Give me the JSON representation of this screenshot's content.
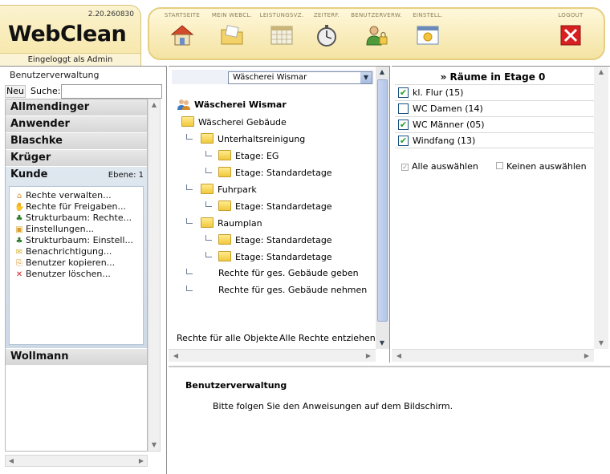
{
  "header": {
    "version": "2.20.260830",
    "brand": "WebClean",
    "logged_in": "Eingeloggt als Admin",
    "nav": [
      {
        "label": "STARTSEITE",
        "icon": "house-icon"
      },
      {
        "label": "MEIN WEBCL.",
        "icon": "folder-icon"
      },
      {
        "label": "LEISTUNGSVZ.",
        "icon": "calendar-icon"
      },
      {
        "label": "ZEITERF.",
        "icon": "stopwatch-icon"
      },
      {
        "label": "BENUTZERVERW.",
        "icon": "user-lock-icon"
      },
      {
        "label": "EINSTELL.",
        "icon": "settings-window-icon"
      },
      {
        "label": "LOGOUT",
        "icon": "close-icon"
      }
    ]
  },
  "left": {
    "title": "Benutzerverwaltung",
    "new_label": "Neu",
    "search_label": "Suche:",
    "search_value": "",
    "users": [
      "Allmendinger",
      "Anwender",
      "Blaschke",
      "Krüger",
      "Kunde",
      "Wollmann"
    ],
    "active_user": "Kunde",
    "active_level": "Ebene: 1",
    "menu": [
      {
        "label": "Rechte verwalten...",
        "icon": "house-small-icon"
      },
      {
        "label": "Rechte für Freigaben...",
        "icon": "share-icon"
      },
      {
        "label": "Strukturbaum: Rechte...",
        "icon": "tree-icon"
      },
      {
        "label": "Einstellungen...",
        "icon": "settings-icon"
      },
      {
        "label": "Strukturbaum: Einstell...",
        "icon": "tree-icon"
      },
      {
        "label": "Benachrichtigung...",
        "icon": "mail-icon"
      },
      {
        "label": "Benutzer kopieren...",
        "icon": "copy-icon"
      },
      {
        "label": "Benutzer löschen...",
        "icon": "delete-icon"
      }
    ]
  },
  "middle": {
    "select_value": "Wäscherei Wismar",
    "root": "Wäscherei Wismar",
    "tree": {
      "building": "Wäscherei Gebäude",
      "unterhalt": "Unterhaltsreinigung",
      "etage_eg": "Etage: EG",
      "etage_std_1": "Etage: Standardetage",
      "fuhrpark": "Fuhrpark",
      "etage_std_2": "Etage: Standardetage",
      "raumplan": "Raumplan",
      "etage_std_3": "Etage: Standardetage",
      "etage_std_4": "Etage: Standardetage",
      "rights_give": "Rechte für ges. Gebäude geben",
      "rights_take": "Rechte für ges. Gebäude nehmen"
    },
    "footer_all": "Rechte für alle Objekte",
    "footer_revoke": "Alle Rechte entziehen"
  },
  "right": {
    "title": "» Räume in Etage 0",
    "rooms": [
      {
        "label": "kl. Flur (15)",
        "checked": true
      },
      {
        "label": "WC Damen (14)",
        "checked": false
      },
      {
        "label": "WC Männer (05)",
        "checked": true
      },
      {
        "label": "Windfang (13)",
        "checked": true
      }
    ],
    "select_all": "Alle auswählen",
    "select_none": "Keinen auswählen"
  },
  "bottom": {
    "title": "Benutzerverwaltung",
    "message": "Bitte folgen Sie den Anweisungen auf dem Bildschirm."
  }
}
